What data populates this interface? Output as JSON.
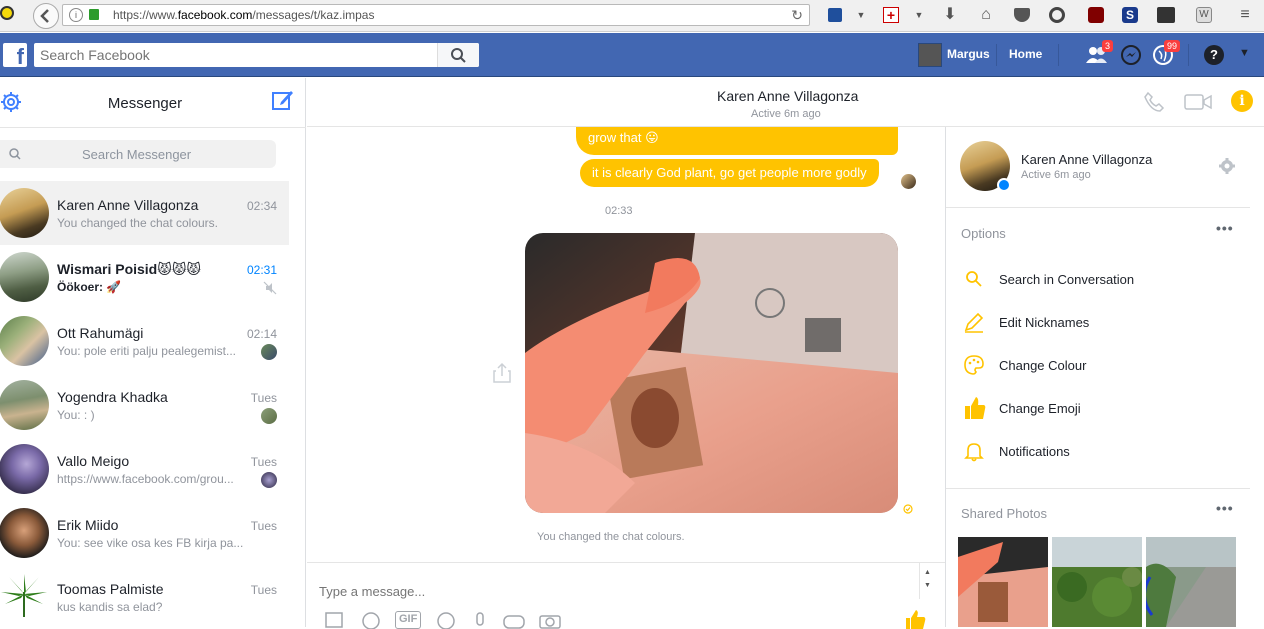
{
  "browser": {
    "url_prefix": "https://www.",
    "url_domain": "facebook.com",
    "url_path": "/messages/t/kaz.impas"
  },
  "fb_bar": {
    "search_placeholder": "Search Facebook",
    "user_name": "Margus",
    "home_label": "Home",
    "friend_requests_badge": "3",
    "notifications_badge": "99"
  },
  "sidebar": {
    "title": "Messenger",
    "search_placeholder": "Search Messenger",
    "conversations": [
      {
        "name": "Karen Anne Villagonza",
        "snippet": "You changed the chat colours.",
        "time": "02:34"
      },
      {
        "name": "Wismari Poisid😾😾😾",
        "snippet": "Öökoer: 🚀",
        "time": "02:31"
      },
      {
        "name": "Ott Rahumägi",
        "snippet": "You: pole eriti palju pealegemist...",
        "time": "02:14"
      },
      {
        "name": "Yogendra Khadka",
        "snippet": "You: : )",
        "time": "Tues"
      },
      {
        "name": "Vallo Meigo",
        "snippet": "https://www.facebook.com/grou...",
        "time": "Tues"
      },
      {
        "name": "Erik Miido",
        "snippet": "You: see vike osa kes FB kirja pa...",
        "time": "Tues"
      },
      {
        "name": "Toomas Palmiste",
        "snippet": "kus kandis sa elad?",
        "time": "Tues"
      }
    ]
  },
  "conversation": {
    "contact_name": "Karen Anne Villagonza",
    "contact_status": "Active 6m ago",
    "messages": [
      {
        "text": "grow that 😛"
      },
      {
        "text": "it is clearly God plant, go get people more godly"
      }
    ],
    "time_stamp": "02:33",
    "status_line": "You changed the chat colours.",
    "composer_placeholder": "Type a message...",
    "gif_label": "GIF"
  },
  "details": {
    "name": "Karen Anne Villagonza",
    "status": "Active 6m ago",
    "options_title": "Options",
    "options": [
      {
        "label": "Search in Conversation",
        "icon": "search-icon"
      },
      {
        "label": "Edit Nicknames",
        "icon": "pencil-icon"
      },
      {
        "label": "Change Colour",
        "icon": "palette-icon"
      },
      {
        "label": "Change Emoji",
        "icon": "thumbs-up-icon"
      },
      {
        "label": "Notifications",
        "icon": "bell-icon"
      }
    ],
    "shared_photos_title": "Shared Photos"
  },
  "colors": {
    "fb_blue": "#4267b2",
    "theme_yellow": "#ffc300",
    "messenger_blue": "#0084ff"
  }
}
